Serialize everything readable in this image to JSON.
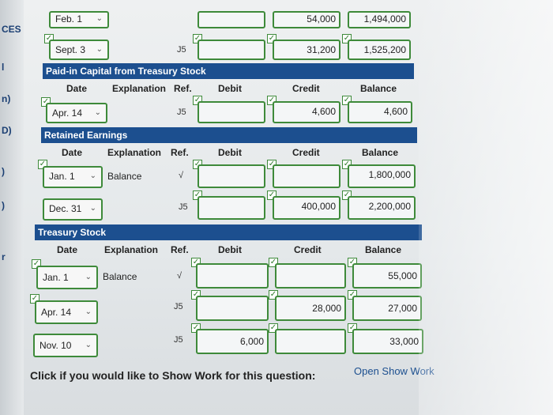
{
  "left_strip": {
    "texts": [
      "CES",
      "l",
      "n)",
      "D)",
      ")",
      ")",
      "r"
    ]
  },
  "top_partial": {
    "date_label": "Feb. 1",
    "credit": "54,000",
    "balance": "1,494,000"
  },
  "common_stock_last": {
    "date": "Sept. 3",
    "ref": "J5",
    "credit": "31,200",
    "balance": "1,525,200"
  },
  "sections": [
    {
      "title": "Paid-in Capital from Treasury Stock",
      "columns": [
        "Date",
        "Explanation",
        "Ref.",
        "Debit",
        "Credit",
        "Balance"
      ],
      "rows": [
        {
          "date": "Apr. 14",
          "explanation": "",
          "ref": "J5",
          "debit": "",
          "credit": "4,600",
          "balance": "4,600"
        }
      ]
    },
    {
      "title": "Retained Earnings",
      "columns": [
        "Date",
        "Explanation",
        "Ref.",
        "Debit",
        "Credit",
        "Balance"
      ],
      "rows": [
        {
          "date": "Jan. 1",
          "explanation": "Balance",
          "ref": "√",
          "debit": "",
          "credit": "",
          "balance": "1,800,000"
        },
        {
          "date": "Dec. 31",
          "explanation": "",
          "ref": "J5",
          "debit": "",
          "credit": "400,000",
          "balance": "2,200,000"
        }
      ]
    },
    {
      "title": "Treasury Stock",
      "columns": [
        "Date",
        "Explanation",
        "Ref.",
        "Debit",
        "Credit",
        "Balance"
      ],
      "rows": [
        {
          "date": "Jan. 1",
          "explanation": "Balance",
          "ref": "√",
          "debit": "",
          "credit": "",
          "balance": "55,000"
        },
        {
          "date": "Apr. 14",
          "explanation": "",
          "ref": "J5",
          "debit": "",
          "credit": "28,000",
          "balance": "27,000"
        },
        {
          "date": "Nov. 10",
          "explanation": "",
          "ref": "J5",
          "debit": "6,000",
          "credit": "",
          "balance": "33,000"
        }
      ]
    }
  ],
  "footer": {
    "question": "Click if you would like to Show Work for this question:",
    "link": "Open Show Work"
  },
  "colors": {
    "header_bg": "#1c4f8f",
    "check_green": "#3e8a3a"
  }
}
